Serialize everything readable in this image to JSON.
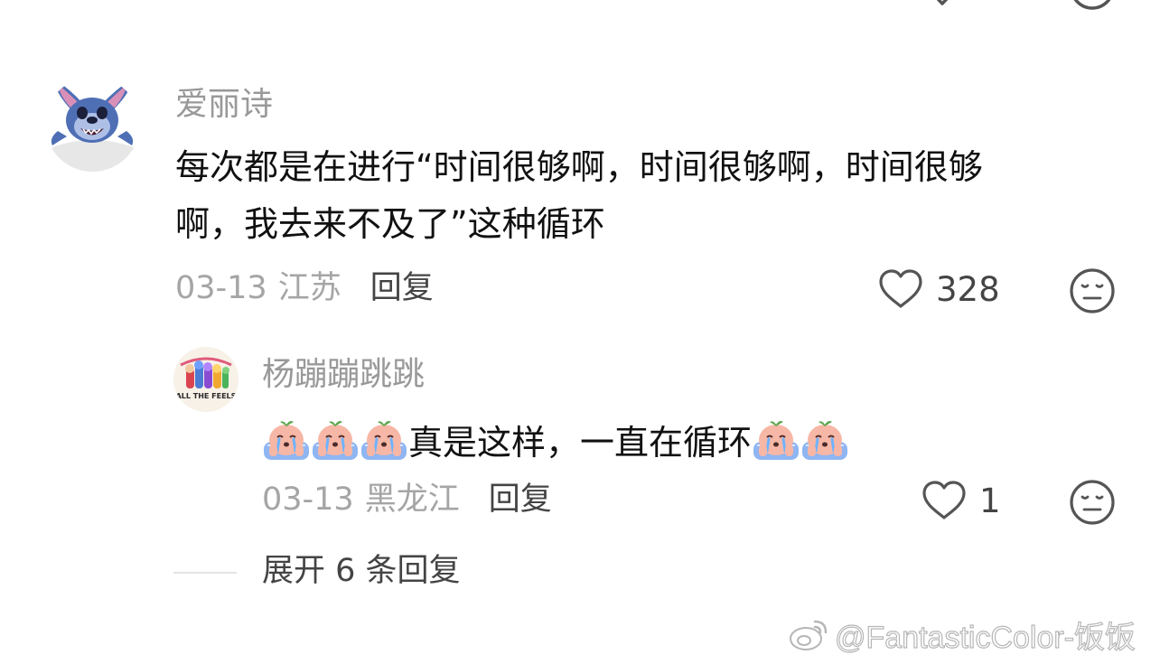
{
  "comment": {
    "username": "爱丽诗",
    "text_line1": "每次都是在进行“时间很够啊，时间很够啊，时间很够",
    "text_line2": "啊，我去来不及了”这种循环",
    "date": "03-13",
    "region": "江苏",
    "reply_label": "回复",
    "like_count": "328",
    "avatar_icon": "stitch-avatar",
    "like_icon": "heart-outline-icon",
    "reaction_icon": "neutral-face-icon"
  },
  "reply": {
    "username": "杨蹦蹦跳跳",
    "text": "真是这样，一直在循环",
    "leading_emoji_count": 3,
    "trailing_emoji_count": 2,
    "emoji_icon": "crying-peach-emoji",
    "date": "03-13",
    "region": "黑龙江",
    "reply_label": "回复",
    "like_count": "1",
    "avatar_icon": "group-illustration-avatar",
    "avatar_sticker_text": "ALL THE FEELS"
  },
  "expand": {
    "label": "展开 6 条回复"
  },
  "watermark": {
    "text": "@FantasticColor-饭饭",
    "icon": "weibo-logo-icon"
  },
  "colors": {
    "primary_text": "#111111",
    "secondary_text": "#999999",
    "meta_text": "#a5a5a5",
    "action_text": "#444444",
    "icon_stroke": "#555555"
  }
}
